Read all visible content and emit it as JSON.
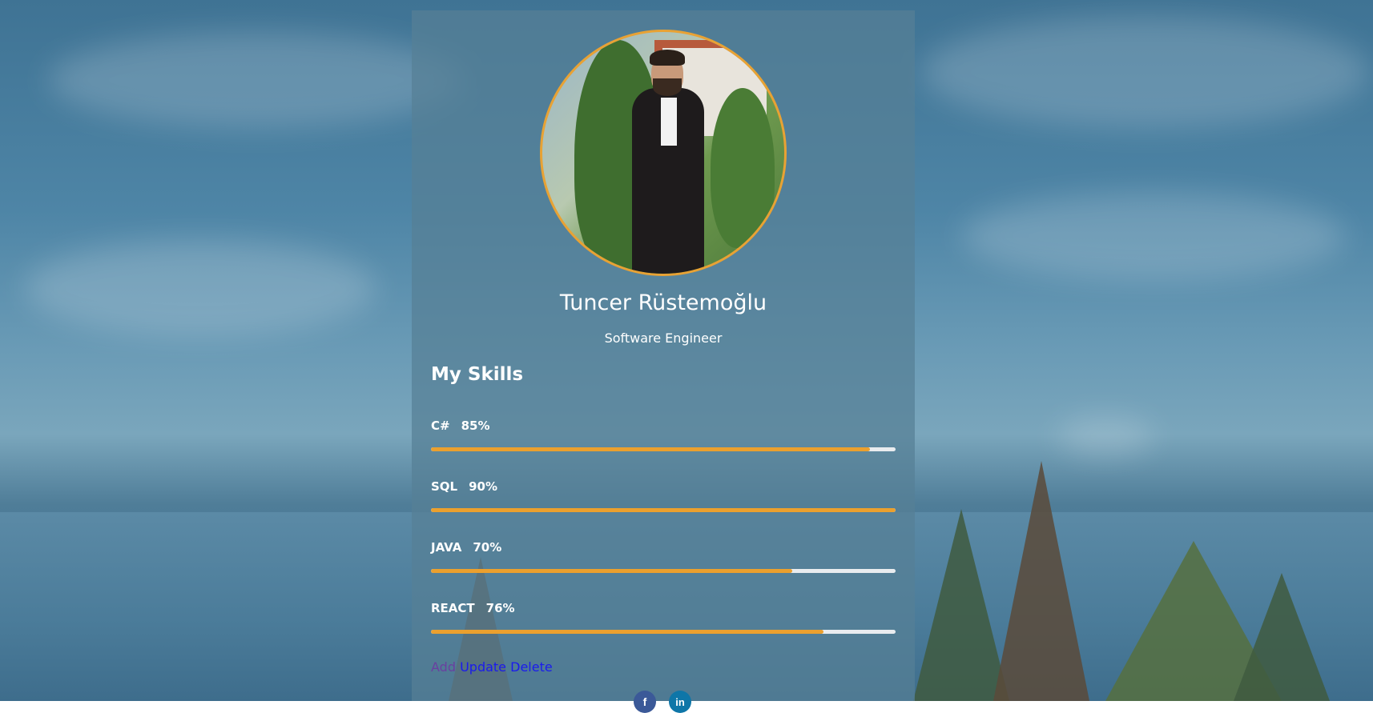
{
  "profile": {
    "name": "Tuncer Rüstemoğlu",
    "title": "Software Engineer"
  },
  "skills": {
    "heading": "My Skills",
    "items": [
      {
        "name": "C#",
        "percent_label": "85%",
        "bar_fill": 0.945
      },
      {
        "name": "SQL",
        "percent_label": "90%",
        "bar_fill": 1.0
      },
      {
        "name": "JAVA",
        "percent_label": "70%",
        "bar_fill": 0.778
      },
      {
        "name": "REACT",
        "percent_label": "76%",
        "bar_fill": 0.844
      }
    ]
  },
  "actions": {
    "add": "Add",
    "update": "Update",
    "delete": "Delete"
  },
  "social": {
    "facebook_glyph": "f",
    "linkedin_glyph": "in"
  },
  "colors": {
    "accent": "#eba02e",
    "avatar_border": "#e8a234",
    "facebook": "#3b5998",
    "linkedin": "#0e76a8"
  }
}
